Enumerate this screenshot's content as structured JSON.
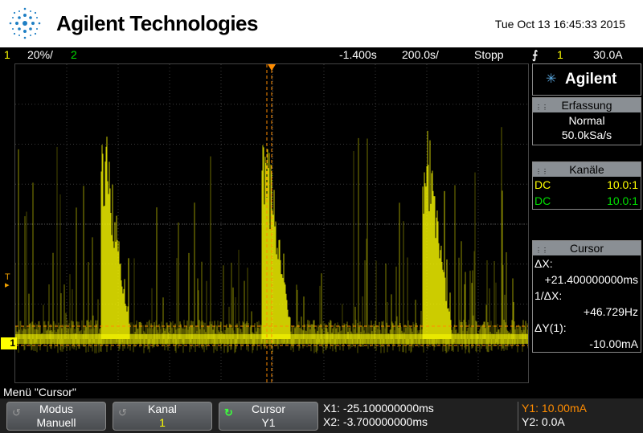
{
  "header": {
    "brand": "Agilent Technologies",
    "datetime": "Tue Oct 13 16:45:33 2015"
  },
  "statusbar": {
    "ch1_num": "1",
    "ch1_scale": "20%/",
    "ch2_num": "2",
    "time_offset": "-1.400s",
    "time_scale": "200.0s/",
    "run_state": "Stopp",
    "trigger_icon": "trigger-edge-icon",
    "trigger_channel": "1",
    "trigger_level": "30.0A"
  },
  "sidepanel": {
    "logo": "Agilent",
    "acquisition": {
      "title": "Erfassung",
      "mode": "Normal",
      "rate": "50.0kSa/s"
    },
    "channels": {
      "title": "Kanäle",
      "rows": [
        {
          "coupling": "DC",
          "probe": "10.0:1",
          "color": "#ffff00"
        },
        {
          "coupling": "DC",
          "probe": "10.0:1",
          "color": "#00e000"
        }
      ]
    },
    "cursor": {
      "title": "Cursor",
      "dx_label": "ΔX:",
      "dx_value": "+21.400000000ms",
      "inv_dx_label": "1/ΔX:",
      "inv_dx_value": "+46.729Hz",
      "dy_label": "ΔY(1):",
      "dy_value": "-10.00mA"
    }
  },
  "menu": {
    "title": "Menü \"Cursor\"",
    "softkeys": [
      {
        "top": "Modus",
        "bottom": "Manuell",
        "icon": "rotate-icon"
      },
      {
        "top": "Kanal",
        "bottom": "1",
        "icon": "rotate-icon"
      },
      {
        "top": "Cursor",
        "bottom": "Y1",
        "icon": "rotate-icon"
      }
    ],
    "cursor_readout": {
      "x1": "X1: -25.100000000ms",
      "x2": "X2: -3.700000000ms"
    },
    "y_readout": {
      "y1": "Y1: 10.00mA",
      "y2": "Y2: 0.0A"
    }
  },
  "markers": {
    "ch1_label": "1",
    "trig_level_label": "T"
  },
  "colors": {
    "ch1": "#ffff00",
    "ch2": "#00e000",
    "cursor": "#ff8c00",
    "grid": "#3a3a3a"
  }
}
